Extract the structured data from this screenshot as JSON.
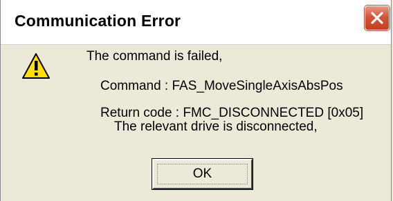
{
  "dialog": {
    "title": "Communication Error",
    "close_icon": "close-icon",
    "warning_icon": "warning-icon",
    "message": "The command is failed,",
    "command_line": "Command : FAS_MoveSingleAxisAbsPos",
    "return_code_line": "Return code : FMC_DISCONNECTED [0x05]",
    "detail_line": "The relevant drive is disconnected,",
    "ok_label": "OK"
  },
  "colors": {
    "dialog_background": "#ece9d8",
    "titlebar_background": "#ffffff",
    "close_button": "#d3563a",
    "warning_yellow": "#ffe000"
  }
}
